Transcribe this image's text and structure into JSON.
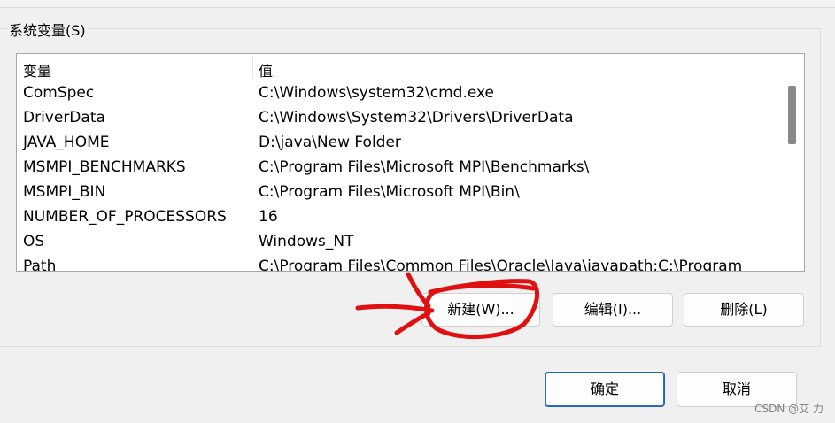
{
  "group": {
    "title": "系统变量(S)"
  },
  "table": {
    "columns": [
      "变量",
      "值"
    ],
    "rows": [
      {
        "name": "ComSpec",
        "value": "C:\\Windows\\system32\\cmd.exe"
      },
      {
        "name": "DriverData",
        "value": "C:\\Windows\\System32\\Drivers\\DriverData"
      },
      {
        "name": "JAVA_HOME",
        "value": "D:\\java\\New Folder"
      },
      {
        "name": "MSMPI_BENCHMARKS",
        "value": "C:\\Program Files\\Microsoft MPI\\Benchmarks\\"
      },
      {
        "name": "MSMPI_BIN",
        "value": "C:\\Program Files\\Microsoft MPI\\Bin\\"
      },
      {
        "name": "NUMBER_OF_PROCESSORS",
        "value": "16"
      },
      {
        "name": "OS",
        "value": "Windows_NT"
      },
      {
        "name": "Path",
        "value": "C:\\Program Files\\Common Files\\Oracle\\Java\\javapath;C:\\Program"
      }
    ]
  },
  "buttons": {
    "new": "新建(W)...",
    "edit": "编辑(I)...",
    "delete": "删除(L)",
    "ok": "确定",
    "cancel": "取消"
  },
  "watermark": "CSDN @艾 力",
  "colors": {
    "annotation": "#e01010",
    "primary_border": "#2067b0"
  }
}
